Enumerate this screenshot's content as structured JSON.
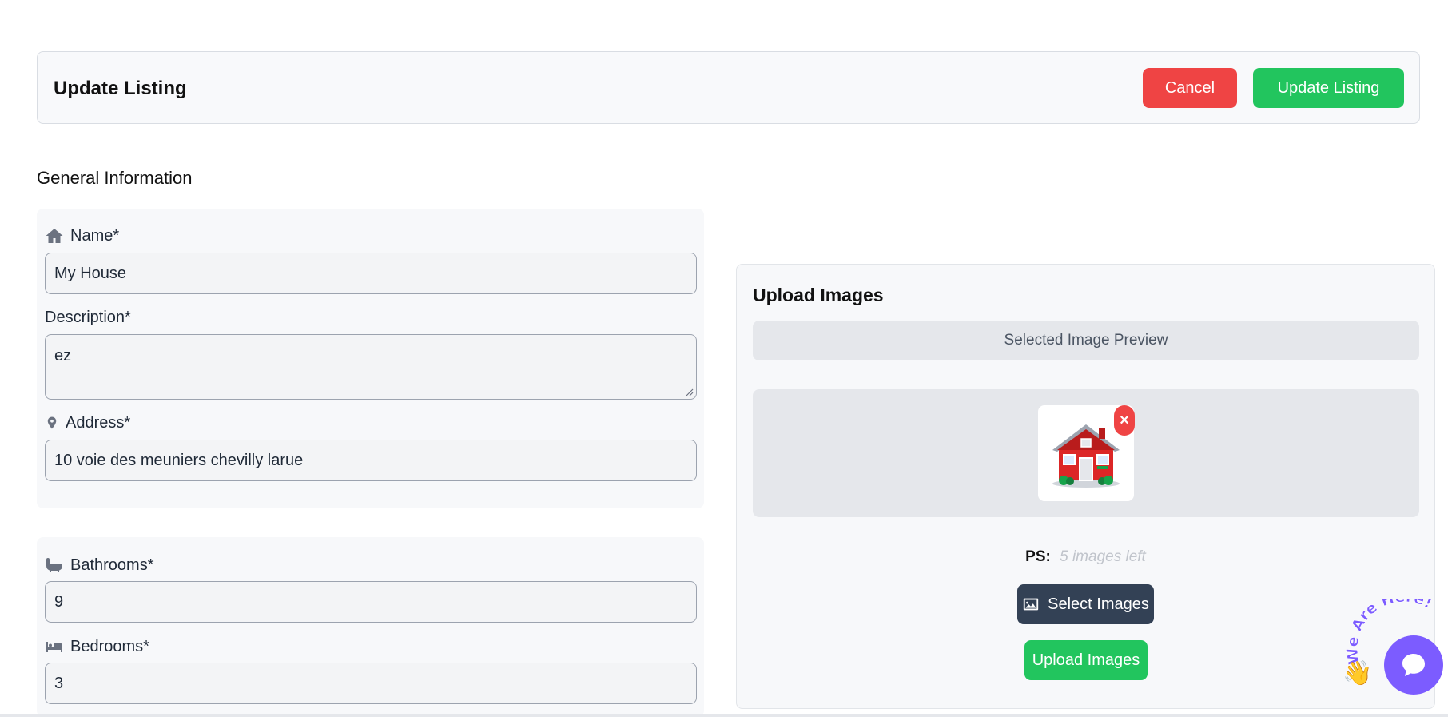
{
  "header": {
    "title": "Update Listing",
    "cancel_label": "Cancel",
    "update_label": "Update Listing"
  },
  "general": {
    "section_title": "General Information",
    "name_label": "Name*",
    "name_value": "My House",
    "description_label": "Description*",
    "description_value": "ez",
    "address_label": "Address*",
    "address_value": "10 voie des meuniers chevilly larue"
  },
  "rooms": {
    "bathrooms_label": "Bathrooms*",
    "bathrooms_value": "9",
    "bedrooms_label": "Bedrooms*",
    "bedrooms_value": "3"
  },
  "upload": {
    "title": "Upload Images",
    "preview_label": "Selected Image Preview",
    "remove_symbol": "×",
    "ps_label": "PS:",
    "ps_value": "5 images left",
    "select_label": "Select Images",
    "upload_label": "Upload Images"
  },
  "chat": {
    "tagline": "We Are Here!"
  },
  "colors": {
    "danger": "#ef4444",
    "success": "#22c55e",
    "dark": "#334155",
    "chat": "#7c5cff"
  }
}
